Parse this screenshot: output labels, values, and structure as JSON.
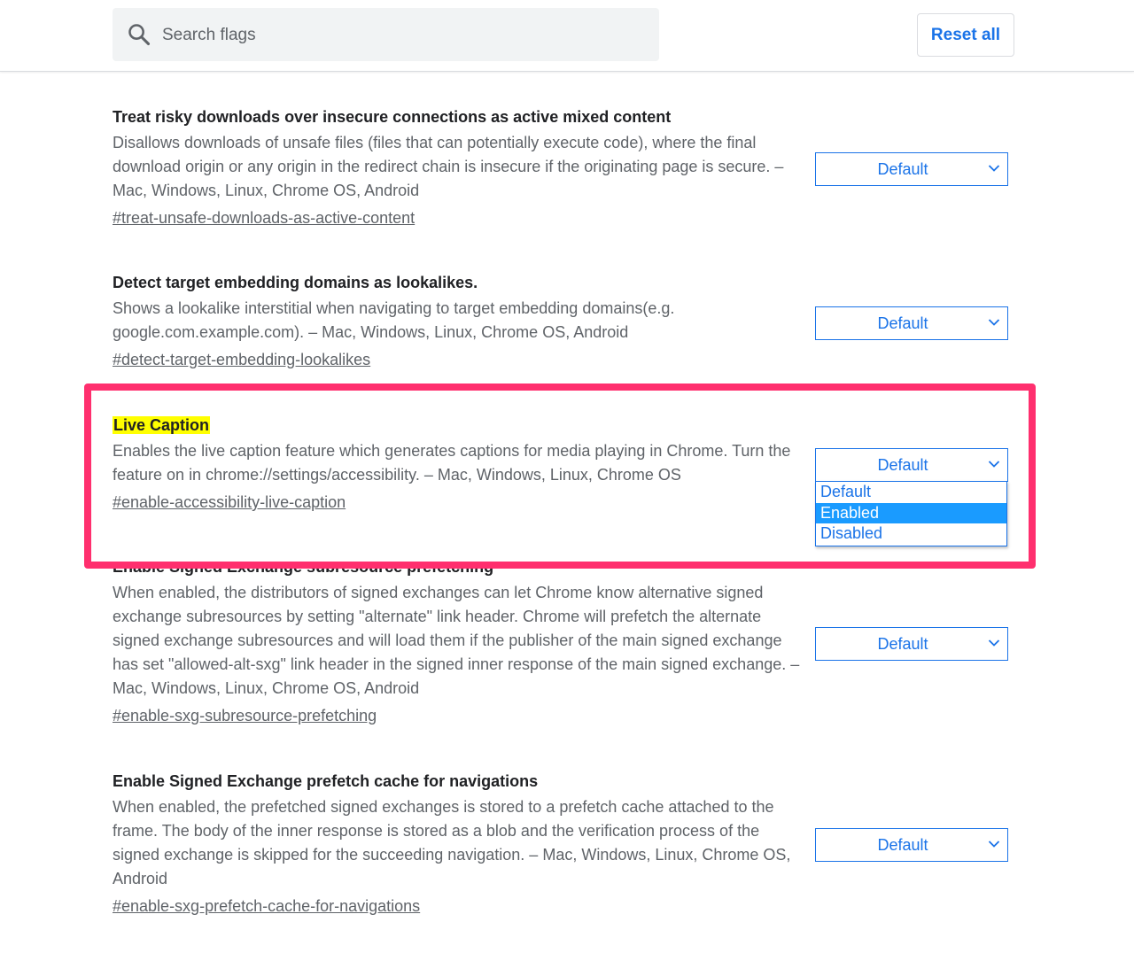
{
  "header": {
    "search_placeholder": "Search flags",
    "reset_label": "Reset all"
  },
  "colors": {
    "accent": "#1a73e8",
    "callout_border": "#ff2f6e",
    "highlight": "#ffff00",
    "selected_option": "#1a9bff"
  },
  "flags": [
    {
      "title": "Treat risky downloads over insecure connections as active mixed content",
      "description": "Disallows downloads of unsafe files (files that can potentially execute code), where the final download origin or any origin in the redirect chain is insecure if the originating page is secure. – Mac, Windows, Linux, Chrome OS, Android",
      "link": "#treat-unsafe-downloads-as-active-content",
      "value": "Default"
    },
    {
      "title": "Detect target embedding domains as lookalikes.",
      "description": "Shows a lookalike interstitial when navigating to target embedding domains(e.g. google.com.example.com). – Mac, Windows, Linux, Chrome OS, Android",
      "link": "#detect-target-embedding-lookalikes",
      "value": "Default"
    },
    {
      "title": "Live Caption",
      "description": "Enables the live caption feature which generates captions for media playing in Chrome. Turn the feature on in chrome://settings/accessibility. – Mac, Windows, Linux, Chrome OS",
      "link": "#enable-accessibility-live-caption",
      "value": "Default",
      "options": [
        "Default",
        "Enabled",
        "Disabled"
      ],
      "highlighted_option": "Enabled"
    },
    {
      "title": "Enable Signed Exchange subresource prefetching",
      "description": "When enabled, the distributors of signed exchanges can let Chrome know alternative signed exchange subresources by setting \"alternate\" link header. Chrome will prefetch the alternate signed exchange subresources and will load them if the publisher of the main signed exchange has set \"allowed-alt-sxg\" link header in the signed inner response of the main signed exchange. – Mac, Windows, Linux, Chrome OS, Android",
      "link": "#enable-sxg-subresource-prefetching",
      "value": "Default"
    },
    {
      "title": "Enable Signed Exchange prefetch cache for navigations",
      "description": "When enabled, the prefetched signed exchanges is stored to a prefetch cache attached to the frame. The body of the inner response is stored as a blob and the verification process of the signed exchange is skipped for the succeeding navigation. – Mac, Windows, Linux, Chrome OS, Android",
      "link": "#enable-sxg-prefetch-cache-for-navigations",
      "value": "Default"
    }
  ]
}
